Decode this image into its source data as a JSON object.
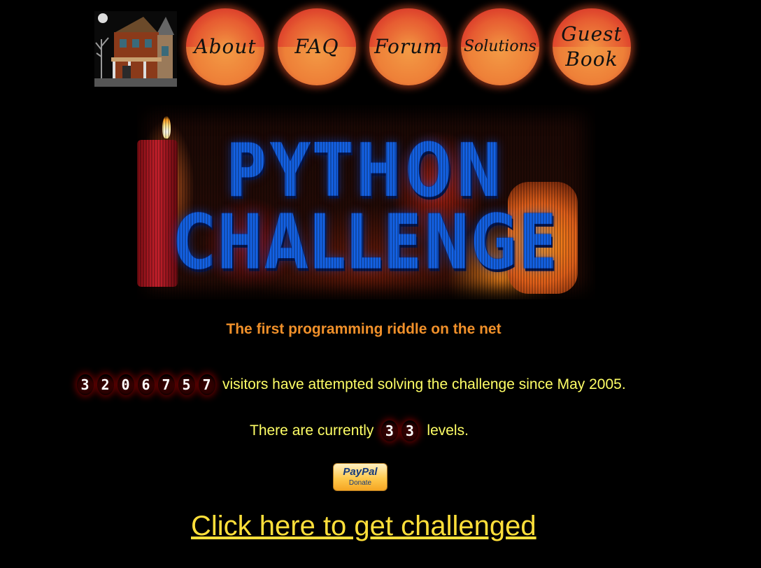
{
  "nav": {
    "about": "About",
    "faq": "FAQ",
    "forum": "Forum",
    "solutions": "Solutions",
    "guest_line1": "Guest",
    "guest_line2": "Book"
  },
  "banner": {
    "line1": "PYTHON",
    "line2": "CHALLENGE"
  },
  "tagline": "The first programming riddle on the net",
  "visitors": {
    "digits": [
      "3",
      "2",
      "0",
      "6",
      "7",
      "5",
      "7"
    ],
    "text": "visitors have attempted solving the challenge since May 2005."
  },
  "levels": {
    "prefix": "There are currently",
    "digits": [
      "3",
      "3"
    ],
    "suffix": "levels."
  },
  "paypal": {
    "logo": "PayPal",
    "label": "Donate"
  },
  "cta": "Click here to get challenged",
  "colors": {
    "tagline": "#f0902a",
    "body_text": "#ffff66",
    "link": "#ffdf3a",
    "nav_orange": "#ee8038"
  }
}
